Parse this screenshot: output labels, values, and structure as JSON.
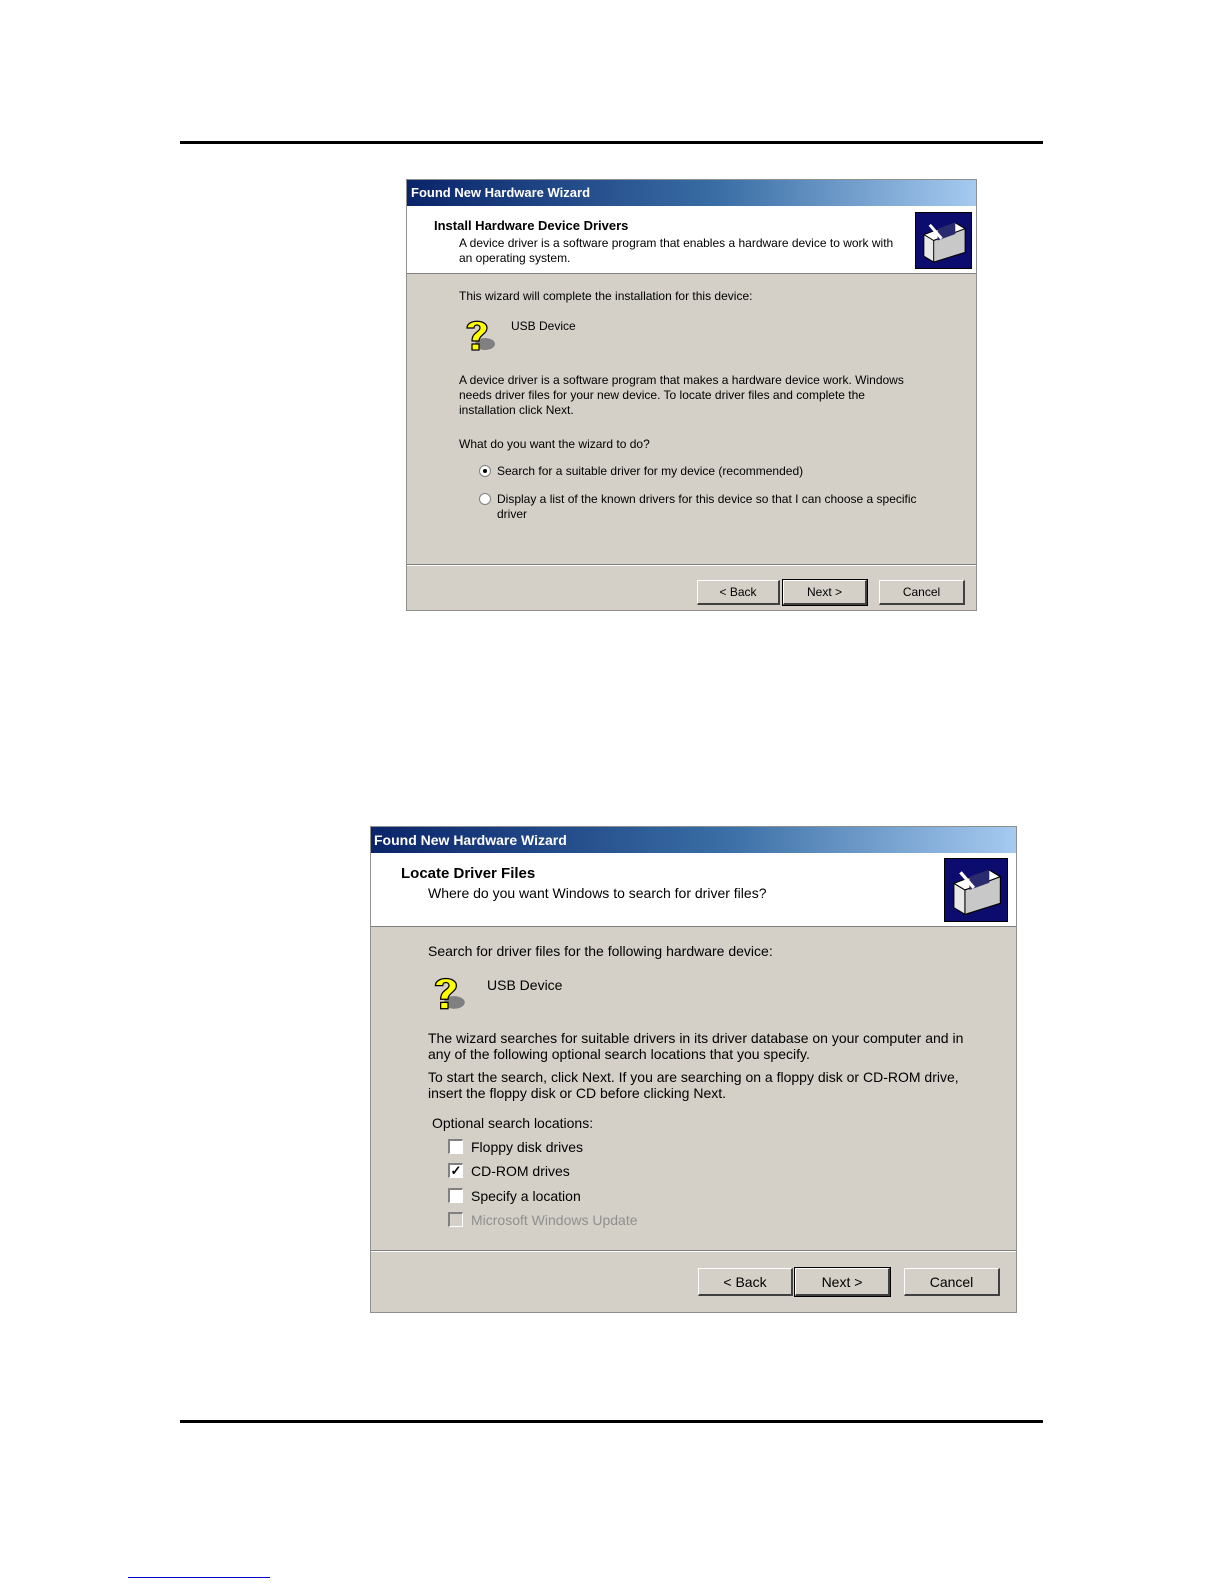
{
  "wizard1": {
    "title": "Found New Hardware Wizard",
    "header_title": "Install Hardware Device Drivers",
    "header_sub_line1": "A device driver is a software program that enables a hardware device to work with",
    "header_sub_line2": "an operating system.",
    "intro": "This wizard will complete the installation for this device:",
    "device": "USB Device",
    "desc_line1": "A device driver is a software program that makes a hardware device work. Windows",
    "desc_line2": "needs driver files for your new device. To locate driver files and complete the",
    "desc_line3": "installation click Next.",
    "question": "What do you want the wizard to do?",
    "option1": "Search for a suitable driver for my device (recommended)",
    "option2_line1": "Display a list of the known drivers for this device so that I can choose a specific",
    "option2_line2": "driver",
    "selected_option": 1,
    "back": "< Back",
    "next": "Next >",
    "cancel": "Cancel"
  },
  "wizard2": {
    "title": "Found New Hardware Wizard",
    "header_title": "Locate Driver Files",
    "header_sub": "Where do you want Windows to search for driver files?",
    "intro": "Search for driver files for the following hardware device:",
    "device": "USB Device",
    "desc_line1": "The wizard searches for suitable drivers in its driver database on your computer and in",
    "desc_line2": "any of the following optional search locations that you specify.",
    "desc_line3": "To start the search, click Next. If you are searching on a floppy disk or CD-ROM drive,",
    "desc_line4": "insert the floppy disk or CD before clicking Next.",
    "optional_label": "Optional search locations:",
    "options": [
      {
        "label": "Floppy disk drives",
        "checked": false,
        "enabled": true
      },
      {
        "label": "CD-ROM drives",
        "checked": true,
        "enabled": true
      },
      {
        "label": "Specify a location",
        "checked": false,
        "enabled": true
      },
      {
        "label": "Microsoft Windows Update",
        "checked": false,
        "enabled": false
      }
    ],
    "back": "< Back",
    "next": "Next >",
    "cancel": "Cancel"
  }
}
